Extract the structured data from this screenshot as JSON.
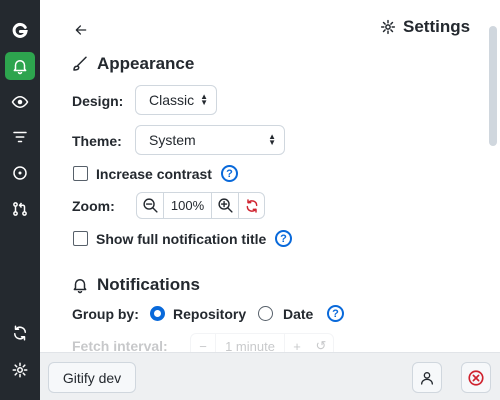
{
  "header": {
    "title": "Settings"
  },
  "sidebar": {
    "items": [
      {
        "name": "logo",
        "icon": "gitify-logo-icon"
      },
      {
        "name": "notifications",
        "icon": "bell-icon",
        "active": true
      },
      {
        "name": "watching",
        "icon": "eye-icon"
      },
      {
        "name": "filters",
        "icon": "filter-icon"
      },
      {
        "name": "issues",
        "icon": "issue-opened-icon"
      },
      {
        "name": "pull-requests",
        "icon": "git-pull-request-icon"
      },
      {
        "name": "refresh",
        "icon": "sync-icon"
      },
      {
        "name": "settings",
        "icon": "gear-icon"
      }
    ]
  },
  "appearance": {
    "title": "Appearance",
    "design_label": "Design:",
    "design_value": "Classic",
    "theme_label": "Theme:",
    "theme_value": "System",
    "contrast_label": "Increase contrast",
    "contrast_checked": false,
    "zoom_label": "Zoom:",
    "zoom_value": "100%",
    "full_title_label": "Show full notification title",
    "full_title_checked": false
  },
  "notifications": {
    "title": "Notifications",
    "group_by_label": "Group by:",
    "group_by_options": [
      "Repository",
      "Date"
    ],
    "group_by_selected": "Repository",
    "fetch_interval_label": "Fetch interval:",
    "fetch_interval_value": "1 minute"
  },
  "footer": {
    "account_button": "Gitify dev"
  },
  "colors": {
    "sidebar": "#24292f",
    "accent_green": "#2da44e",
    "accent_blue": "#0969da",
    "danger": "#cf222e"
  }
}
